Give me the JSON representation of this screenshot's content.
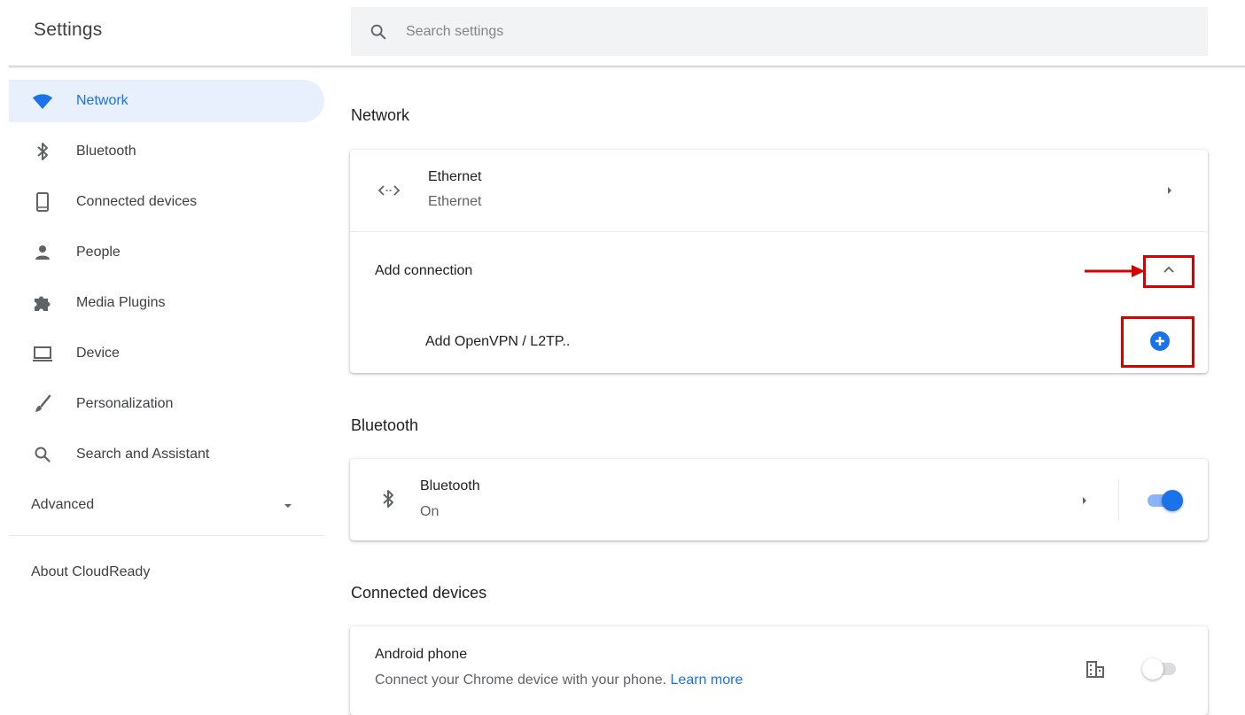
{
  "header": {
    "title": "Settings",
    "search_placeholder": "Search settings",
    "search_value": ""
  },
  "sidebar": {
    "items": [
      {
        "label": "Network",
        "icon": "wifi-icon",
        "active": true
      },
      {
        "label": "Bluetooth",
        "icon": "bluetooth-icon"
      },
      {
        "label": "Connected devices",
        "icon": "phone-device-icon"
      },
      {
        "label": "People",
        "icon": "person-icon"
      },
      {
        "label": "Media Plugins",
        "icon": "puzzle-icon"
      },
      {
        "label": "Device",
        "icon": "laptop-icon"
      },
      {
        "label": "Personalization",
        "icon": "brush-icon"
      },
      {
        "label": "Search and Assistant",
        "icon": "search-icon"
      }
    ],
    "advanced_label": "Advanced",
    "about_label": "About CloudReady"
  },
  "network": {
    "section_title": "Network",
    "ethernet": {
      "title": "Ethernet",
      "subtitle": "Ethernet",
      "icon": "ethernet-icon"
    },
    "add_connection_label": "Add connection",
    "add_vpn_label": "Add OpenVPN / L2TP..",
    "add_icon": "add-circle-icon"
  },
  "bluetooth": {
    "section_title": "Bluetooth",
    "title": "Bluetooth",
    "status": "On",
    "toggle_on": true
  },
  "connected_devices": {
    "section_title": "Connected devices",
    "android_title": "Android phone",
    "android_desc": "Connect your Chrome device with your phone.",
    "learn_more": "Learn more",
    "toggle_on": false
  },
  "colors": {
    "accent": "#1a73e8",
    "annotation_red": "#d50000",
    "active_nav_bg": "#e8f0fe"
  }
}
